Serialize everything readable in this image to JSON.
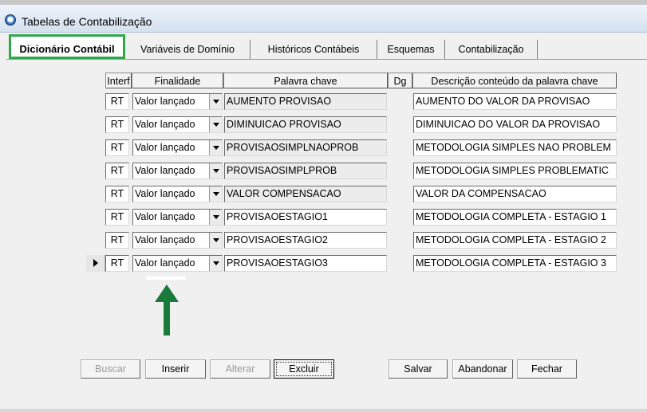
{
  "window": {
    "title": "Tabelas de Contabilização"
  },
  "tabs": [
    {
      "label": "Dicionário Contábil",
      "active": true
    },
    {
      "label": "Variáveis de Domínio"
    },
    {
      "label": "Históricos Contábeis"
    },
    {
      "label": "Esquemas"
    },
    {
      "label": "Contabilização"
    }
  ],
  "grid": {
    "columns": [
      "Interf",
      "Finalidade",
      "Palavra chave",
      "Dg",
      "Descrição conteúdo da palavra chave"
    ],
    "rows": [
      {
        "interf": "RT",
        "finalidade": "Valor lançado",
        "palavra": "AUMENTO PROVISAO",
        "descricao": "AUMENTO DO VALOR DA PROVISAO"
      },
      {
        "interf": "RT",
        "finalidade": "Valor lançado",
        "palavra": "DIMINUICAO PROVISAO",
        "descricao": "DIMINUICAO DO VALOR DA PROVISAO"
      },
      {
        "interf": "RT",
        "finalidade": "Valor lançado",
        "palavra": "PROVISAOSIMPLNAOPROB",
        "descricao": "METODOLOGIA SIMPLES NAO PROBLEM"
      },
      {
        "interf": "RT",
        "finalidade": "Valor lançado",
        "palavra": "PROVISAOSIMPLPROB",
        "descricao": "METODOLOGIA SIMPLES PROBLEMATIC"
      },
      {
        "interf": "RT",
        "finalidade": "Valor lançado",
        "palavra": "VALOR COMPENSACAO",
        "descricao": "VALOR DA COMPENSACAO"
      },
      {
        "interf": "RT",
        "finalidade": "Valor lançado",
        "palavra": "PROVISAOESTAGIO1",
        "descricao": "METODOLOGIA COMPLETA - ESTAGIO 1"
      },
      {
        "interf": "RT",
        "finalidade": "Valor lançado",
        "palavra": "PROVISAOESTAGIO2",
        "descricao": "METODOLOGIA COMPLETA - ESTAGIO 2"
      },
      {
        "interf": "RT",
        "finalidade": "Valor lançado",
        "palavra": "PROVISAOESTAGIO3",
        "descricao": "METODOLOGIA COMPLETA - ESTAGIO 3"
      }
    ]
  },
  "buttons": {
    "buscar": "Buscar",
    "inserir": "Inserir",
    "alterar": "Alterar",
    "excluir": "Excluir",
    "salvar": "Salvar",
    "abandonar": "Abandonar",
    "fechar": "Fechar"
  },
  "colors": {
    "highlight": "#2ea84a",
    "arrow": "#1a7a3c"
  }
}
